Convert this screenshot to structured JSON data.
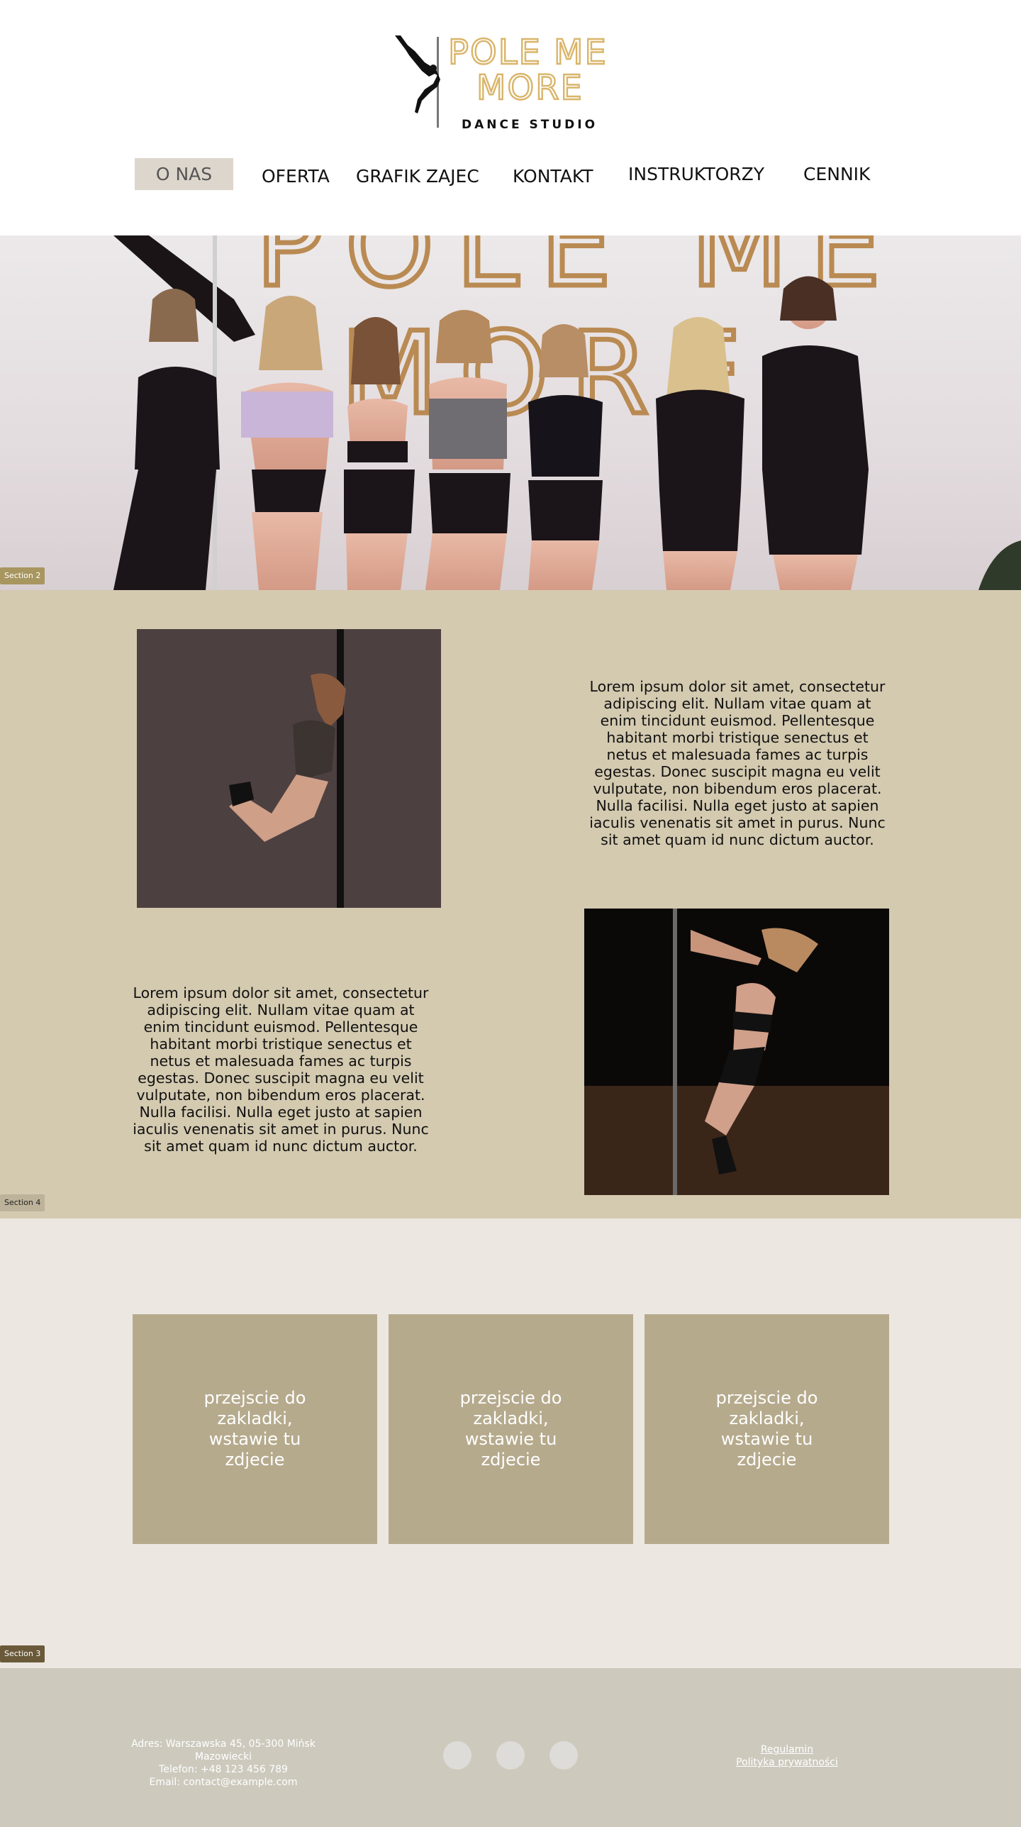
{
  "brand": {
    "logo_line1": "POLE ME",
    "logo_line2": "MORE",
    "logo_tagline": "DANCE STUDIO",
    "accent_gold": "#d9b56a",
    "figure_icon": "pole-dancer-figure"
  },
  "nav": {
    "items": [
      {
        "label": "O NAS",
        "active": true
      },
      {
        "label": "OFERTA"
      },
      {
        "label": "GRAFIK ZAJEC"
      },
      {
        "label": "KONTAKT"
      },
      {
        "label": "INSTRUKTORZY"
      },
      {
        "label": "CENNIK"
      }
    ]
  },
  "hero": {
    "wall_sign_line1": "POLE ME",
    "wall_sign_line2": "MORE",
    "section_tag": "Section 2"
  },
  "about": {
    "paragraph1": "Lorem ipsum dolor sit amet, consectetur adipiscing elit. Nullam vitae quam at enim tincidunt euismod. Pellentesque habitant morbi tristique senectus et netus et malesuada fames ac turpis egestas. Donec suscipit magna eu velit vulputate, non bibendum eros placerat. Nulla facilisi. Nulla eget justo at sapien iaculis venenatis sit amet in purus. Nunc sit amet quam id nunc dictum auctor.",
    "paragraph2": "Lorem ipsum dolor sit amet, consectetur adipiscing elit. Nullam vitae quam at enim tincidunt euismod. Pellentesque habitant morbi tristique senectus et netus et malesuada fames ac turpis egestas. Donec suscipit magna eu velit vulputate, non bibendum eros placerat. Nulla facilisi. Nulla eget justo at sapien iaculis venenatis sit amet in purus. Nunc sit amet quam id nunc dictum auctor.",
    "section_tag": "Section 4"
  },
  "cards": {
    "items": [
      {
        "label": "przejscie do zakladki, wstawie tu zdjecie"
      },
      {
        "label": "przejscie do zakladki, wstawie tu zdjecie"
      },
      {
        "label": "przejscie do zakladki, wstawie tu zdjecie"
      }
    ],
    "section_tag": "Section 3"
  },
  "footer": {
    "address_line1": "Adres: Warszawska 45, 05-300 Mińsk",
    "address_line2": "Mazowiecki",
    "phone": "Telefon: +48 123 456 789",
    "email": "Email: contact@example.com",
    "link_terms": "Regulamin",
    "link_privacy": "Polityka prywatności"
  },
  "colors": {
    "nav_active_bg": "#ddd6cc",
    "section4_bg": "#d4cab0",
    "section3_bg": "#ece7e1",
    "card_bg": "#b6aa8d",
    "footer_bg": "#cdc9bd",
    "tag_section2": "#a89660",
    "tag_section4": "#bdb39a",
    "tag_section3": "#6b5a3a"
  }
}
